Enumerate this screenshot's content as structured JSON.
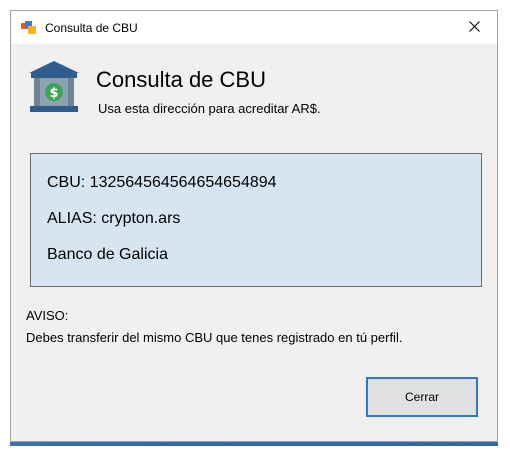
{
  "window": {
    "title": "Consulta de CBU"
  },
  "header": {
    "title": "Consulta de CBU",
    "subtitle": "Usa esta dirección para acreditar AR$."
  },
  "info": {
    "cbu": "CBU: 1325645645646546548​94",
    "alias": "ALIAS: crypton.ars",
    "bank": "Banco de Galicia"
  },
  "notice": {
    "title": "AVISO:",
    "text": "Debes transferir del mismo CBU que tenes registrado en tú perfil."
  },
  "buttons": {
    "close_label": "Cerrar"
  },
  "colors": {
    "info_background": "#d7e4f2",
    "focus_border": "#2b78d4",
    "bank_body": "#8ea1b0",
    "money_green": "#3aa655"
  }
}
